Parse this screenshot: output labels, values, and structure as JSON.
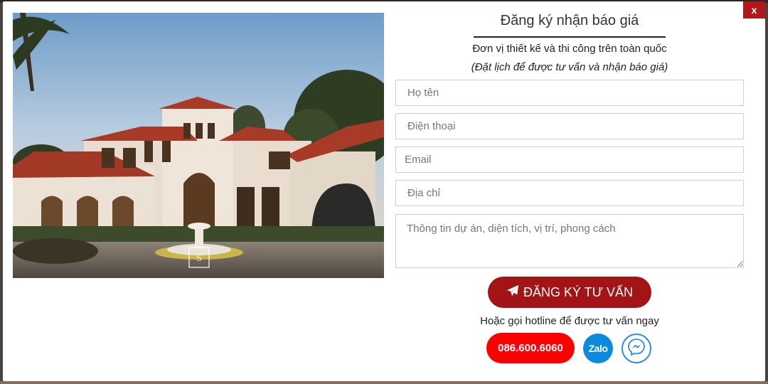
{
  "close_label": "x",
  "form": {
    "title": "Đăng ký nhận báo giá",
    "subtitle": "Đơn vị thiết kế và thi công trên toàn quốc",
    "subnote": "(Đặt lịch để được tư vấn và nhận báo giá)",
    "fields": {
      "name_placeholder": "Họ tên",
      "phone_placeholder": "Điện thoại",
      "email_placeholder": "Email",
      "address_placeholder": "Địa chỉ",
      "project_placeholder": "Thông tin dự án, diện tích, vị trí, phong cách"
    },
    "submit_label": "ĐĂNG KÝ TƯ VẤN",
    "hotline_text": "Hoặc gọi hotline để được tư vấn ngay",
    "phone_number": "086.600.6060",
    "zalo_label": "Zalo"
  },
  "icons": {
    "submit": "paper-plane-icon",
    "messenger": "messenger-icon"
  },
  "colors": {
    "brand_red": "#a31416",
    "close_red": "#b3171b",
    "phone_red": "#ff0000",
    "zalo_blue": "#0a8be0",
    "messenger_blue": "#2d8cf0"
  }
}
